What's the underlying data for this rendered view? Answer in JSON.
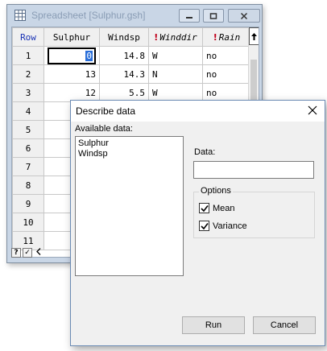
{
  "spreadsheet": {
    "title": "Spreadsheet [Sulphur.gsh]",
    "columns": [
      {
        "label": "Row"
      },
      {
        "label": "Sulphur"
      },
      {
        "label": "Windsp"
      },
      {
        "label": "Winddir",
        "marker": "!"
      },
      {
        "label": "Rain",
        "marker": "!"
      }
    ],
    "rows": [
      {
        "row": "1",
        "sulphur": "0",
        "windsp": "14.8",
        "winddir": "W",
        "rain": "no"
      },
      {
        "row": "2",
        "sulphur": "13",
        "windsp": "14.3",
        "winddir": "N",
        "rain": "no"
      },
      {
        "row": "3",
        "sulphur": "12",
        "windsp": "5.5",
        "winddir": "W",
        "rain": "no"
      },
      {
        "row": "4"
      },
      {
        "row": "5"
      },
      {
        "row": "6"
      },
      {
        "row": "7"
      },
      {
        "row": "8"
      },
      {
        "row": "9"
      },
      {
        "row": "10"
      },
      {
        "row": "11"
      }
    ],
    "bottom": {
      "help_label": "?",
      "check_label": "✓"
    }
  },
  "dialog": {
    "title": "Describe data",
    "available_label": "Available data:",
    "available_items": [
      "Sulphur",
      "Windsp"
    ],
    "data_label": "Data:",
    "data_value": "",
    "options_label": "Options",
    "options": [
      {
        "label": "Mean",
        "checked": true
      },
      {
        "label": "Variance",
        "checked": true
      }
    ],
    "run_label": "Run",
    "cancel_label": "Cancel"
  },
  "colors": {
    "row_header": "#1a33b5",
    "text_col_header_bg": "#fde8e8",
    "marker": "#c0001a",
    "selection": "#2b6fd9"
  }
}
